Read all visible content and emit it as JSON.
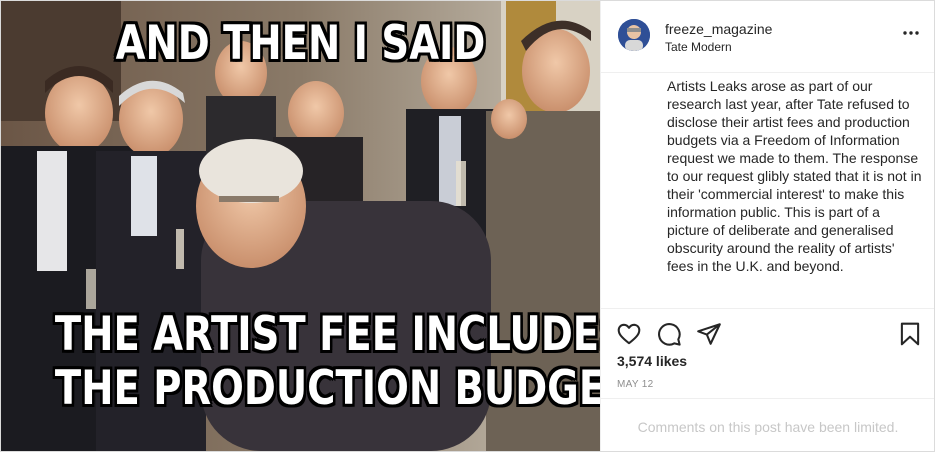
{
  "meme": {
    "top_text": "AND THEN I SAID",
    "bottom_text_line1": "THE ARTIST FEE INCLUDES",
    "bottom_text_line2": "THE PRODUCTION BUDGET"
  },
  "post": {
    "username": "freeze_magazine",
    "location": "Tate Modern",
    "caption": "Artists Leaks arose as part of our research last year, after Tate refused to disclose their artist fees and production budgets via a Freedom of Information request we made to them. The response to our request glibly stated that it is not in their 'commercial interest' to make this information public. This is part of a picture of deliberate and generalised obscurity around the reality of artists' fees in the U.K. and beyond.",
    "likes": "3,574 likes",
    "date": "MAY 12",
    "comments_notice": "Comments on this post have been limited."
  },
  "icons": {
    "more": "more-options-icon",
    "like": "heart-icon",
    "comment": "comment-icon",
    "share": "paper-plane-icon",
    "save": "bookmark-icon"
  },
  "colors": {
    "text": "#262626",
    "muted": "#8e8e8e",
    "border": "#efefef",
    "limited_text": "#c7c7c7"
  }
}
